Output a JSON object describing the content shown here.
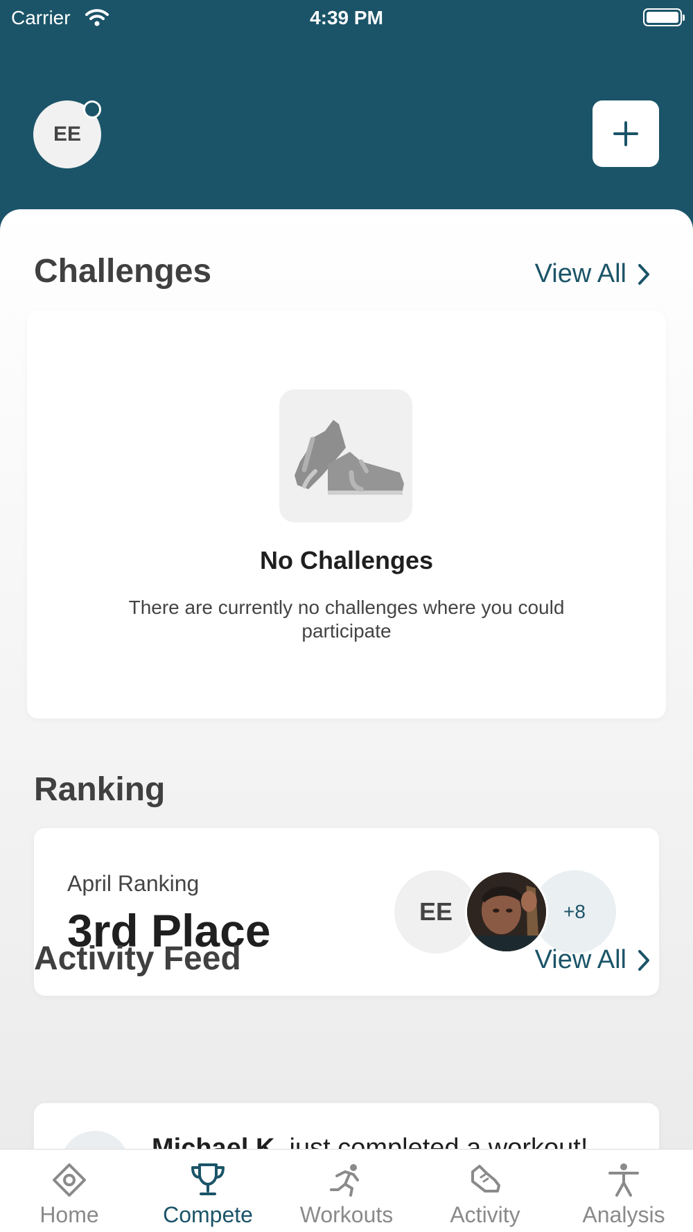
{
  "status_bar": {
    "carrier": "Carrier",
    "time": "4:39 PM"
  },
  "header": {
    "avatar_initials": "EE"
  },
  "challenges": {
    "title": "Challenges",
    "view_all": "View All",
    "empty_title": "No Challenges",
    "empty_description": "There are currently no challenges where you could participate"
  },
  "ranking": {
    "title": "Ranking",
    "label": "April Ranking",
    "place": "3rd Place",
    "participants": {
      "first_initials": "EE",
      "more_count": "+8"
    }
  },
  "activity_feed": {
    "title": "Activity Feed",
    "view_all": "View All",
    "first_item": {
      "user": "Michael K.",
      "text": "just completed a workout!"
    }
  },
  "tabs": [
    {
      "label": "Home",
      "icon": "home-icon",
      "active": false
    },
    {
      "label": "Compete",
      "icon": "trophy-icon",
      "active": true
    },
    {
      "label": "Workouts",
      "icon": "runner-icon",
      "active": false
    },
    {
      "label": "Activity",
      "icon": "shoe-icon",
      "active": false
    },
    {
      "label": "Analysis",
      "icon": "person-icon",
      "active": false
    }
  ],
  "colors": {
    "brand": "#1b5468",
    "inactive_tab": "#8a8a8a"
  }
}
